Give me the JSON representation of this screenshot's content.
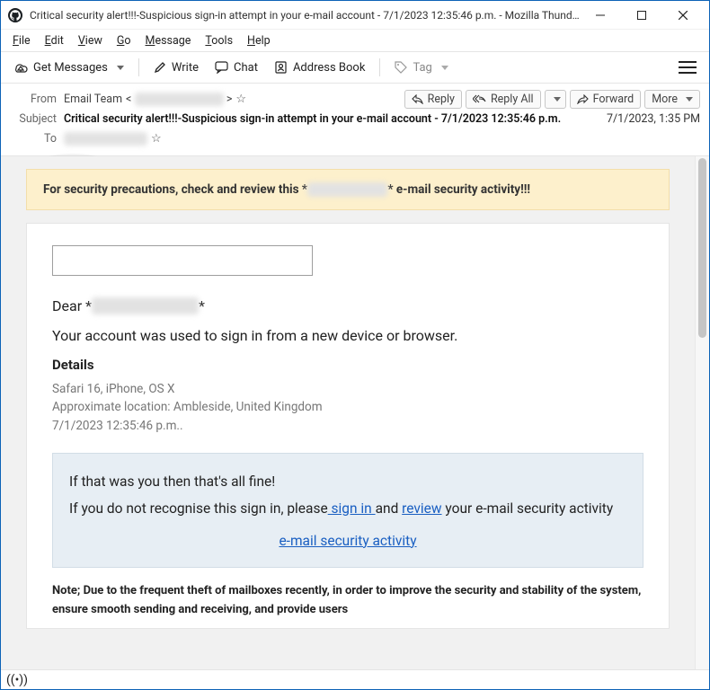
{
  "window": {
    "title": "Critical security alert!!!-Suspicious sign-in attempt in your e-mail account - 7/1/2023 12:35:46 p.m. - Mozilla Thunderbird"
  },
  "menu": {
    "file": "File",
    "edit": "Edit",
    "view": "View",
    "go": "Go",
    "message": "Message",
    "tools": "Tools",
    "help": "Help"
  },
  "toolbar": {
    "get_messages": "Get Messages",
    "write": "Write",
    "chat": "Chat",
    "address_book": "Address Book",
    "tag": "Tag"
  },
  "headers": {
    "from_label": "From",
    "from_name": "Email Team",
    "subject_label": "Subject",
    "subject": "Critical security alert!!!-Suspicious sign-in attempt in your e-mail account - 7/1/2023 12:35:46 p.m.",
    "to_label": "To",
    "date_received": "7/1/2023, 1:35 PM"
  },
  "actions": {
    "reply": "Reply",
    "reply_all": "Reply All",
    "forward": "Forward",
    "more": "More"
  },
  "body": {
    "banner_pre": "For security precautions, check and review this *",
    "banner_post": "* e-mail security activity!!!",
    "dear_pre": "Dear *",
    "dear_post": "*",
    "signin": "Your account was used to sign in from a new device or browser.",
    "details_heading": "Details",
    "ua": "Safari 16, iPhone, OS X",
    "location": "Approximate location: Ambleside, United Kingdom",
    "timestamp": "7/1/2023 12:35:46 p.m..",
    "ok_line": "If that was you then that's all fine!",
    "prompt_pre": "If you do not recognise this sign in, please",
    "sign_in_link": " sign in ",
    "prompt_mid": "and ",
    "review_link": "review",
    "prompt_post": " your e-mail security activity",
    "activity_link": " e-mail security activity",
    "note": "Note; Due to the frequent theft of mailboxes recently, in order to improve the security and stability of the system, ensure smooth sending and receiving, and provide users"
  }
}
